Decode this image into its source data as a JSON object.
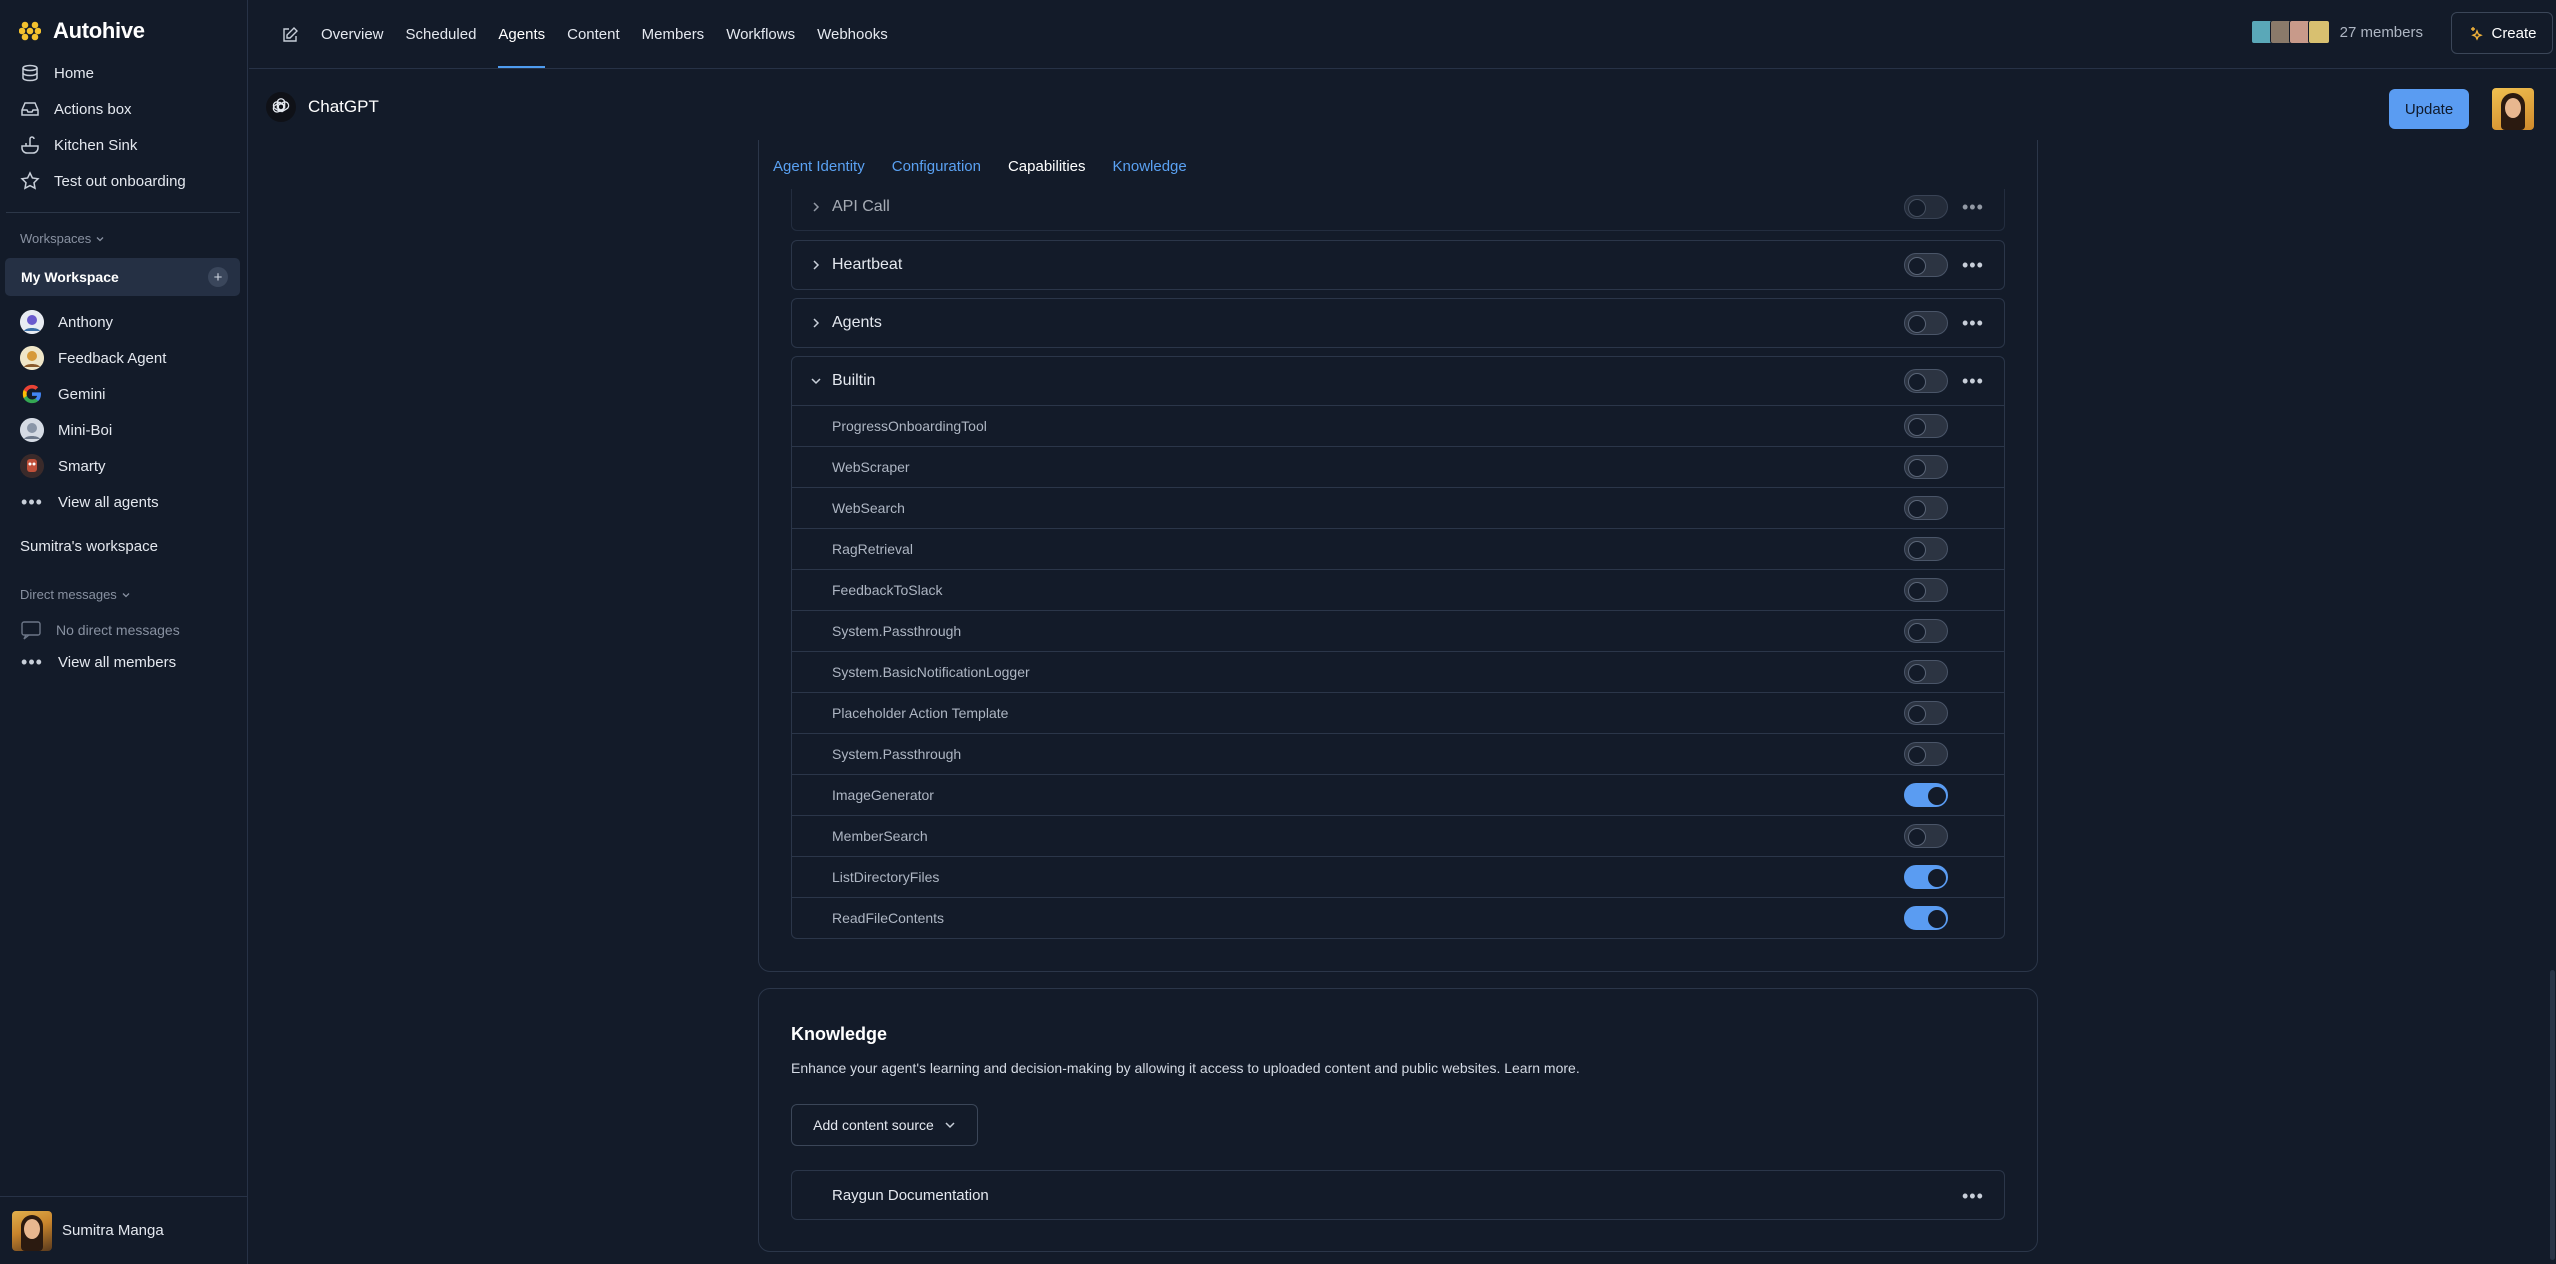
{
  "app": {
    "name": "Autohive"
  },
  "sidebar": {
    "nav": [
      {
        "label": "Home",
        "icon": "home-icon"
      },
      {
        "label": "Actions box",
        "icon": "inbox-icon"
      },
      {
        "label": "Kitchen Sink",
        "icon": "sink-icon"
      },
      {
        "label": "Test out onboarding",
        "icon": "star-icon"
      }
    ],
    "workspaces_label": "Workspaces",
    "current_workspace": "My Workspace",
    "agents": [
      {
        "label": "Anthony"
      },
      {
        "label": "Feedback Agent"
      },
      {
        "label": "Gemini"
      },
      {
        "label": "Mini-Boi"
      },
      {
        "label": "Smarty"
      }
    ],
    "view_all_agents": "View all agents",
    "other_workspace": "Sumitra's workspace",
    "dm_label": "Direct messages",
    "no_dm": "No direct messages",
    "view_all_members": "View all members",
    "user_name": "Sumitra Manga"
  },
  "topbar": {
    "tabs": [
      "Overview",
      "Scheduled",
      "Agents",
      "Content",
      "Members",
      "Workflows",
      "Webhooks"
    ],
    "active_tab": "Agents",
    "members_count": "27 members",
    "create_label": "Create"
  },
  "agent": {
    "name": "ChatGPT",
    "update_label": "Update",
    "subtabs": [
      "Agent Identity",
      "Configuration",
      "Capabilities",
      "Knowledge"
    ],
    "active_subtab": "Capabilities"
  },
  "capabilities": {
    "groups": [
      {
        "name": "API Call",
        "enabled": false,
        "expanded": false
      },
      {
        "name": "Heartbeat",
        "enabled": false,
        "expanded": false
      },
      {
        "name": "Agents",
        "enabled": false,
        "expanded": false
      },
      {
        "name": "Builtin",
        "enabled": false,
        "expanded": true
      }
    ],
    "builtin_tools": [
      {
        "name": "ProgressOnboardingTool",
        "enabled": false
      },
      {
        "name": "WebScraper",
        "enabled": false
      },
      {
        "name": "WebSearch",
        "enabled": false
      },
      {
        "name": "RagRetrieval",
        "enabled": false
      },
      {
        "name": "FeedbackToSlack",
        "enabled": false
      },
      {
        "name": "System.Passthrough",
        "enabled": false
      },
      {
        "name": "System.BasicNotificationLogger",
        "enabled": false
      },
      {
        "name": "Placeholder Action Template",
        "enabled": false
      },
      {
        "name": "System.Passthrough",
        "enabled": false
      },
      {
        "name": "ImageGenerator",
        "enabled": true
      },
      {
        "name": "MemberSearch",
        "enabled": false
      },
      {
        "name": "ListDirectoryFiles",
        "enabled": true
      },
      {
        "name": "ReadFileContents",
        "enabled": true
      }
    ]
  },
  "knowledge": {
    "title": "Knowledge",
    "description": "Enhance your agent's learning and decision-making by allowing it access to uploaded content and public websites. Learn more.",
    "add_source_label": "Add content source",
    "sources": [
      "Raygun Documentation"
    ]
  },
  "colors": {
    "accent": "#5a9cf2",
    "background": "#131b29",
    "border": "#2b3649"
  }
}
